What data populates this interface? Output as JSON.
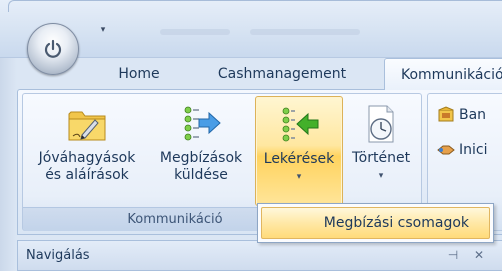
{
  "titlebar": {
    "qat_dropdown_glyph": "▾"
  },
  "tabs": [
    {
      "label": "Home"
    },
    {
      "label": "Cashmanagement"
    },
    {
      "label": "Kommunikáció"
    }
  ],
  "ribbon": {
    "group_label": "Kommunikáció",
    "buttons": {
      "jova": {
        "line1": "Jóváhagyások",
        "line2": "és aláírások",
        "icon": "folder-pen-icon"
      },
      "megb": {
        "line1": "Megbízások",
        "line2": "küldése",
        "icon": "send-list-icon"
      },
      "leke": {
        "line1": "Lekérések",
        "dropdown": "▾",
        "icon": "receive-list-icon"
      },
      "tort": {
        "line1": "Történet",
        "dropdown": "▾",
        "icon": "history-clock-icon"
      }
    },
    "side_group": {
      "item1": "Ban",
      "item2": "Inici"
    }
  },
  "menu": {
    "item": "Megbízási csomagok"
  },
  "nav": {
    "title": "Navigálás",
    "pin_glyph": "⊣",
    "close_glyph": "✕"
  },
  "colors": {
    "accent_highlight": "#ffd35e",
    "ribbon_bg": "#dbe6f4",
    "text": "#1e395b"
  }
}
